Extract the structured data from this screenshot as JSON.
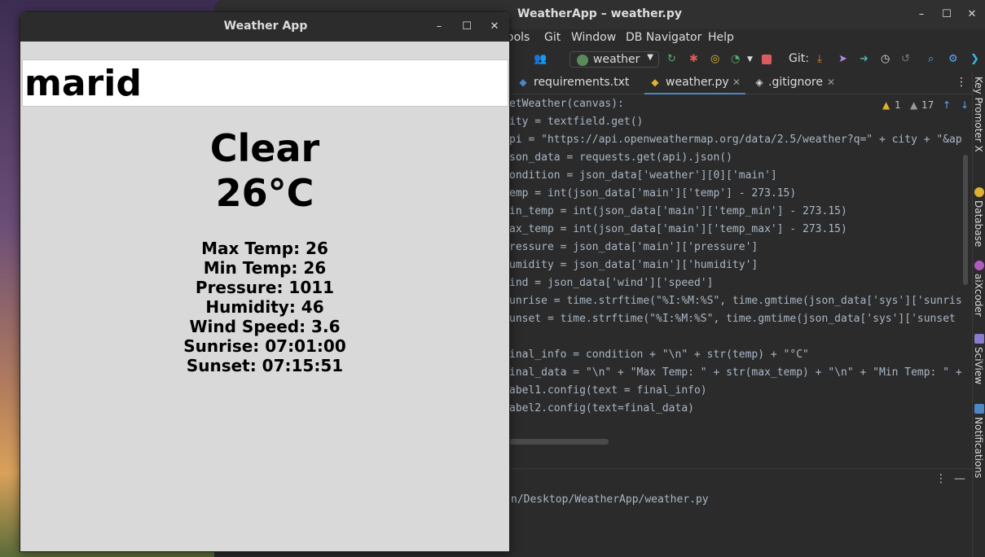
{
  "ide": {
    "title": "WeatherApp – weather.py",
    "menu": [
      "Tools",
      "Git",
      "Window",
      "DB Navigator",
      "Help"
    ],
    "menu_visible_first": "ools",
    "run_config": "weather",
    "git_label": "Git:",
    "tabs": [
      {
        "label": "requirements.txt",
        "icon": "python-file-icon"
      },
      {
        "label": "weather.py",
        "icon": "python-file-icon"
      },
      {
        "label": ".gitignore",
        "icon": "gitignore-icon"
      }
    ],
    "inspections": {
      "warnings": "1",
      "weak_warnings": "17"
    },
    "code_lines": [
      "etWeather(canvas):",
      "ity = textfield.get()",
      "pi = \"https://api.openweathermap.org/data/2.5/weather?q=\" + city + \"&ap",
      "son_data = requests.get(api).json()",
      "ondition = json_data['weather'][0]['main']",
      "emp = int(json_data['main']['temp'] - 273.15)",
      "in_temp = int(json_data['main']['temp_min'] - 273.15)",
      "ax_temp = int(json_data['main']['temp_max'] - 273.15)",
      "ressure = json_data['main']['pressure']",
      "umidity = json_data['main']['humidity']",
      "ind = json_data['wind']['speed']",
      "unrise = time.strftime(\"%I:%M:%S\", time.gmtime(json_data['sys']['sunris",
      "unset = time.strftime(\"%I:%M:%S\", time.gmtime(json_data['sys']['sunset",
      "",
      "inal_info = condition + \"\\n\" + str(temp) + \"°C\"",
      "inal_data = \"\\n\" + \"Max Temp: \" + str(max_temp) + \"\\n\" + \"Min Temp: \" +",
      "abel1.config(text = final_info)",
      "abel2.config(text=final_data)"
    ],
    "terminal_line": "n/Desktop/WeatherApp/weather.py",
    "side_tools": [
      "Key Promoter X",
      "Database",
      "aiXcoder",
      "SciView",
      "Notifications"
    ]
  },
  "weather_app": {
    "title": "Weather App",
    "city_value": "marid",
    "condition": "Clear",
    "temp": "26°C",
    "details": {
      "max_temp": "Max Temp: 26",
      "min_temp": "Min Temp: 26",
      "pressure": "Pressure: 1011",
      "humidity": "Humidity: 46",
      "wind_speed": "Wind Speed: 3.6",
      "sunrise": "Sunrise: 07:01:00",
      "sunset": "Sunset: 07:15:51"
    }
  }
}
